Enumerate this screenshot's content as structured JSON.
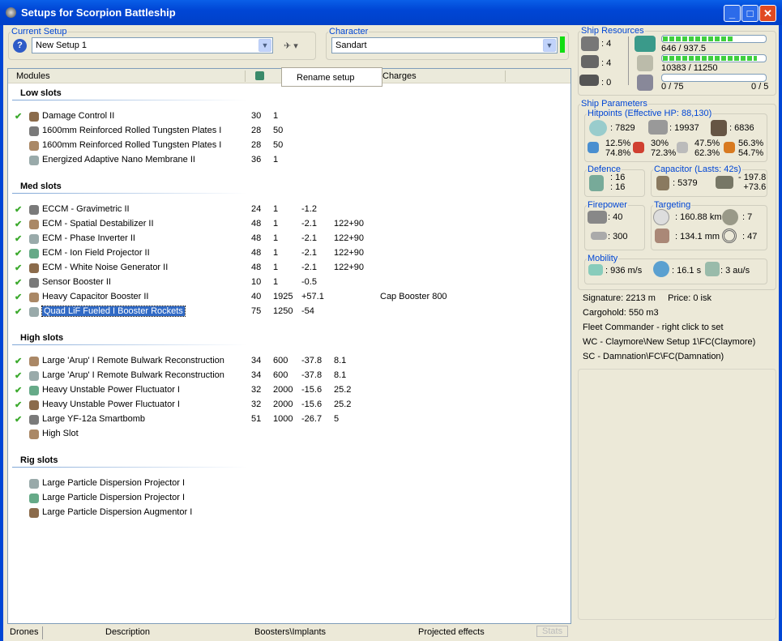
{
  "window": {
    "title": "Setups for Scorpion Battleship"
  },
  "current_setup": {
    "legend": "Current Setup",
    "value": "New Setup 1"
  },
  "character": {
    "legend": "Character",
    "value": "Sandart"
  },
  "columns": {
    "modules": "Modules",
    "charges": "Charges"
  },
  "popup": {
    "rename": "Rename setup"
  },
  "slots": [
    {
      "title": "Low slots",
      "items": [
        {
          "check": true,
          "name": "Damage Control II",
          "c1": "30",
          "c2": "1",
          "c3": "",
          "c4": "",
          "charge": ""
        },
        {
          "check": false,
          "name": "1600mm Reinforced Rolled Tungsten Plates I",
          "c1": "28",
          "c2": "50",
          "c3": "",
          "c4": "",
          "charge": ""
        },
        {
          "check": false,
          "name": "1600mm Reinforced Rolled Tungsten Plates I",
          "c1": "28",
          "c2": "50",
          "c3": "",
          "c4": "",
          "charge": ""
        },
        {
          "check": false,
          "name": "Energized Adaptive Nano Membrane II",
          "c1": "36",
          "c2": "1",
          "c3": "",
          "c4": "",
          "charge": ""
        }
      ]
    },
    {
      "title": "Med slots",
      "items": [
        {
          "check": true,
          "name": "ECCM - Gravimetric II",
          "c1": "24",
          "c2": "1",
          "c3": "-1.2",
          "c4": "",
          "charge": ""
        },
        {
          "check": true,
          "name": "ECM - Spatial Destabilizer II",
          "c1": "48",
          "c2": "1",
          "c3": "-2.1",
          "c4": "122+90",
          "charge": ""
        },
        {
          "check": true,
          "name": "ECM - Phase Inverter II",
          "c1": "48",
          "c2": "1",
          "c3": "-2.1",
          "c4": "122+90",
          "charge": ""
        },
        {
          "check": true,
          "name": "ECM - Ion Field Projector II",
          "c1": "48",
          "c2": "1",
          "c3": "-2.1",
          "c4": "122+90",
          "charge": ""
        },
        {
          "check": true,
          "name": "ECM - White Noise Generator II",
          "c1": "48",
          "c2": "1",
          "c3": "-2.1",
          "c4": "122+90",
          "charge": ""
        },
        {
          "check": true,
          "name": "Sensor Booster II",
          "c1": "10",
          "c2": "1",
          "c3": "-0.5",
          "c4": "",
          "charge": ""
        },
        {
          "check": true,
          "name": "Heavy Capacitor Booster II",
          "c1": "40",
          "c2": "1925",
          "c3": "+57.1",
          "c4": "",
          "charge": "Cap Booster 800"
        },
        {
          "check": true,
          "name": "Quad LiF Fueled I Booster Rockets",
          "c1": "75",
          "c2": "1250",
          "c3": "-54",
          "c4": "",
          "charge": "",
          "selected": true
        }
      ]
    },
    {
      "title": "High slots",
      "items": [
        {
          "check": true,
          "name": "Large 'Arup' I Remote Bulwark Reconstruction",
          "c1": "34",
          "c2": "600",
          "c3": "-37.8",
          "c4": "8.1",
          "charge": ""
        },
        {
          "check": true,
          "name": "Large 'Arup' I Remote Bulwark Reconstruction",
          "c1": "34",
          "c2": "600",
          "c3": "-37.8",
          "c4": "8.1",
          "charge": ""
        },
        {
          "check": true,
          "name": "Heavy Unstable Power Fluctuator I",
          "c1": "32",
          "c2": "2000",
          "c3": "-15.6",
          "c4": "25.2",
          "charge": ""
        },
        {
          "check": true,
          "name": "Heavy Unstable Power Fluctuator I",
          "c1": "32",
          "c2": "2000",
          "c3": "-15.6",
          "c4": "25.2",
          "charge": ""
        },
        {
          "check": true,
          "name": "Large YF-12a Smartbomb",
          "c1": "51",
          "c2": "1000",
          "c3": "-26.7",
          "c4": "5",
          "charge": ""
        },
        {
          "check": false,
          "name": "High Slot",
          "c1": "",
          "c2": "",
          "c3": "",
          "c4": "",
          "charge": ""
        }
      ]
    },
    {
      "title": "Rig slots",
      "items": [
        {
          "check": false,
          "name": "Large Particle Dispersion Projector I",
          "c1": "",
          "c2": "",
          "c3": "",
          "c4": "",
          "charge": ""
        },
        {
          "check": false,
          "name": "Large Particle Dispersion Projector I",
          "c1": "",
          "c2": "",
          "c3": "",
          "c4": "",
          "charge": ""
        },
        {
          "check": false,
          "name": "Large Particle Dispersion Augmentor I",
          "c1": "",
          "c2": "",
          "c3": "",
          "c4": "",
          "charge": ""
        }
      ]
    }
  ],
  "bottom_tabs": [
    "Drones",
    "Description",
    "Boosters\\Implants",
    "Projected effects",
    "Stats"
  ],
  "resources": {
    "legend": "Ship Resources",
    "turrets": ": 4",
    "launchers": ": 4",
    "rigs": ": 0",
    "cpu": {
      "text": "646 / 937.5",
      "fraction": 0.689
    },
    "power": {
      "text": "10383 / 11250",
      "fraction": 0.923
    },
    "drone": {
      "text": "0 / 75",
      "fraction": 0,
      "count": "0 / 5"
    }
  },
  "params": {
    "legend": "Ship Parameters",
    "hp": {
      "legend": "Hitpoints (Effective HP: 88,130)",
      "shield": ": 7829",
      "armor": ": 19937",
      "hull": ": 6836",
      "res": [
        [
          "12.5%",
          "74.8%"
        ],
        [
          "30%",
          "72.3%"
        ],
        [
          "47.5%",
          "62.3%"
        ],
        [
          "56.3%",
          "54.7%"
        ]
      ]
    },
    "defence": {
      "legend": "Defence",
      "a": ": 16",
      "b": ": 16"
    },
    "capacitor": {
      "legend": "Capacitor (Lasts: 42s)",
      "value": ": 5379",
      "use": "- 197.8",
      "regen": "+73.6"
    },
    "firepower": {
      "legend": "Firepower",
      "a": ": 40",
      "b": ": 300"
    },
    "targeting": {
      "legend": "Targeting",
      "range": ": 160.88 km",
      "targets": ": 7",
      "res": ": 134.1 mm",
      "sensor": ": 47"
    },
    "mobility": {
      "legend": "Mobility",
      "speed": ": 936 m/s",
      "align": ": 16.1 s",
      "warp": ": 3 au/s"
    }
  },
  "info": [
    "Signature: 2213 m     Price: 0 isk",
    "Cargohold: 550 m3",
    "Fleet Commander - right click to set",
    "WC - Claymore\\New Setup 1\\FC(Claymore)",
    "SC - Damnation\\FC\\FC(Damnation)"
  ],
  "colors": {
    "accent": "#0046D5",
    "check": "#3DAA2E",
    "selection": "#316AC5",
    "bar": "#3FCF3F"
  }
}
